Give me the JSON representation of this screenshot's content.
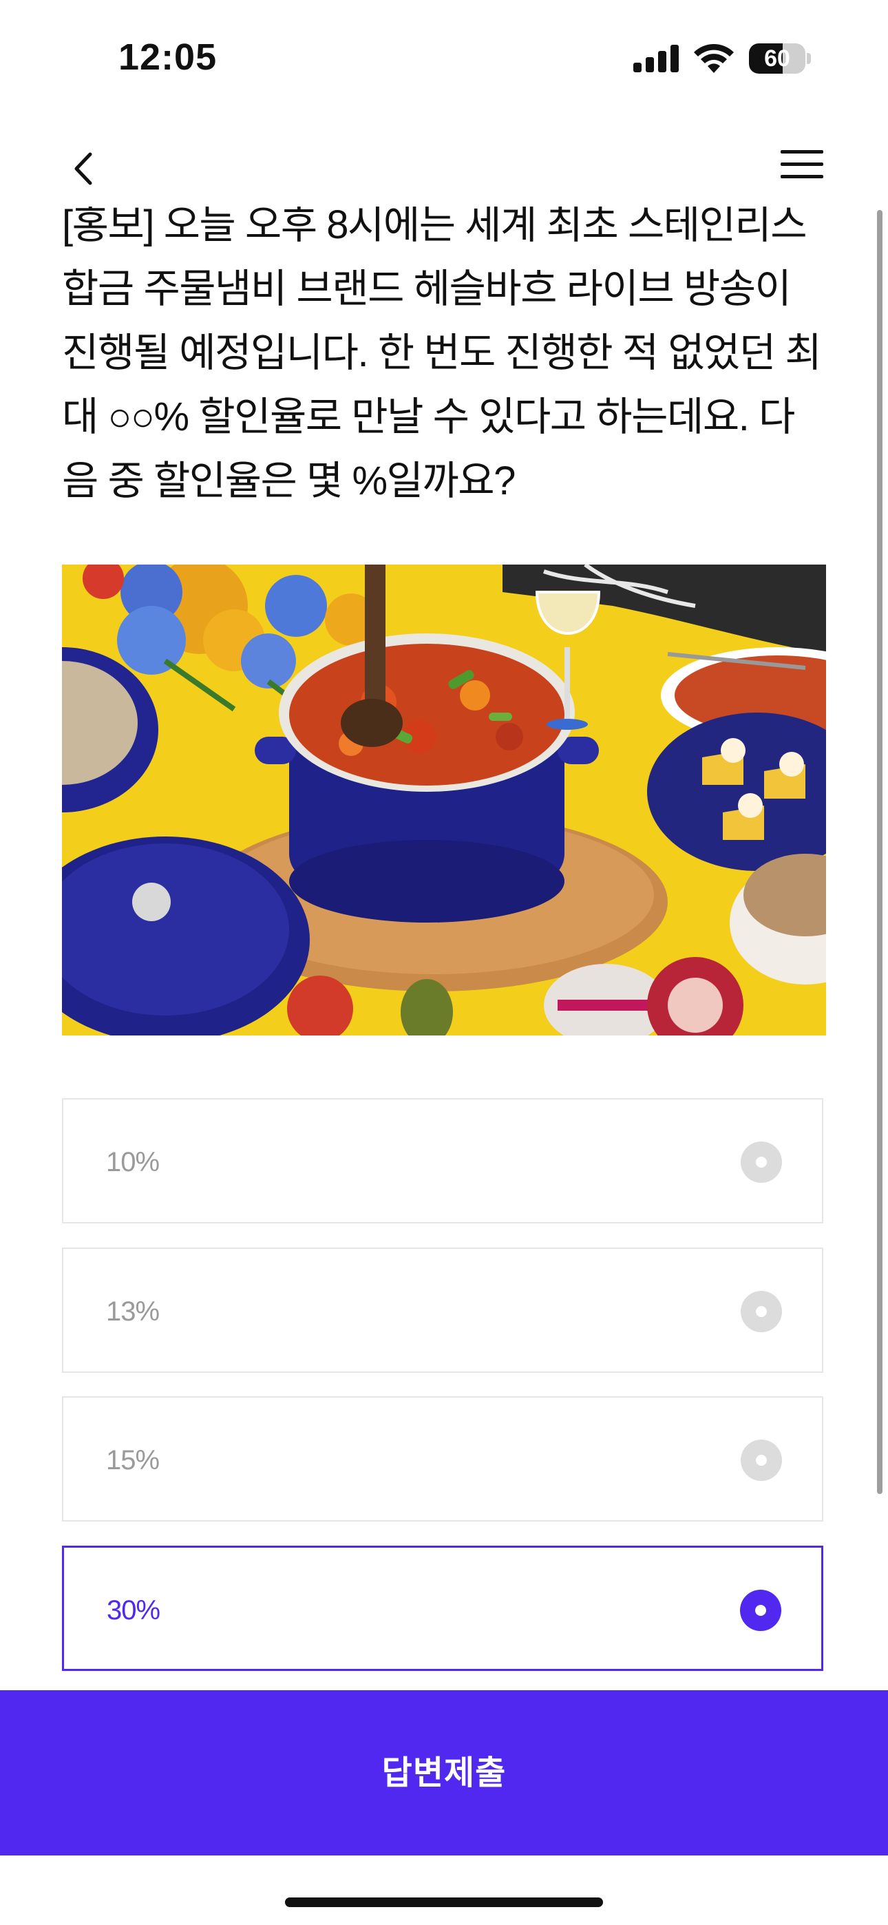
{
  "status_bar": {
    "time": "12:05",
    "battery": "60",
    "battery_level": 0.6,
    "icons": [
      "cellular-signal-icon",
      "wifi-icon",
      "battery-icon"
    ]
  },
  "nav": {
    "back_icon": "chevron-left-icon",
    "menu_icon": "hamburger-menu-icon"
  },
  "quiz": {
    "question": "[홍보] 오늘 오후 8시에는 세계 최초 스테인리스 합금 주물냄비 브랜드 헤슬바흐 라이브 방송이 진행될 예정입니다. 한 번도 진행한 적 없었던 최대 ○○% 할인율로 만날 수 있다고 하는데요. 다음 중 할인율은 몇 %일까요?",
    "options": [
      {
        "label": "10%",
        "selected": false
      },
      {
        "label": "13%",
        "selected": false
      },
      {
        "label": "15%",
        "selected": false
      },
      {
        "label": "30%",
        "selected": true
      }
    ]
  },
  "submit": {
    "label": "답변제출"
  },
  "colors": {
    "accent": "#5028f0",
    "option_border": "#e6e6e6",
    "option_text": "#9a9a9a",
    "radio_inactive": "#dcdcdc"
  }
}
